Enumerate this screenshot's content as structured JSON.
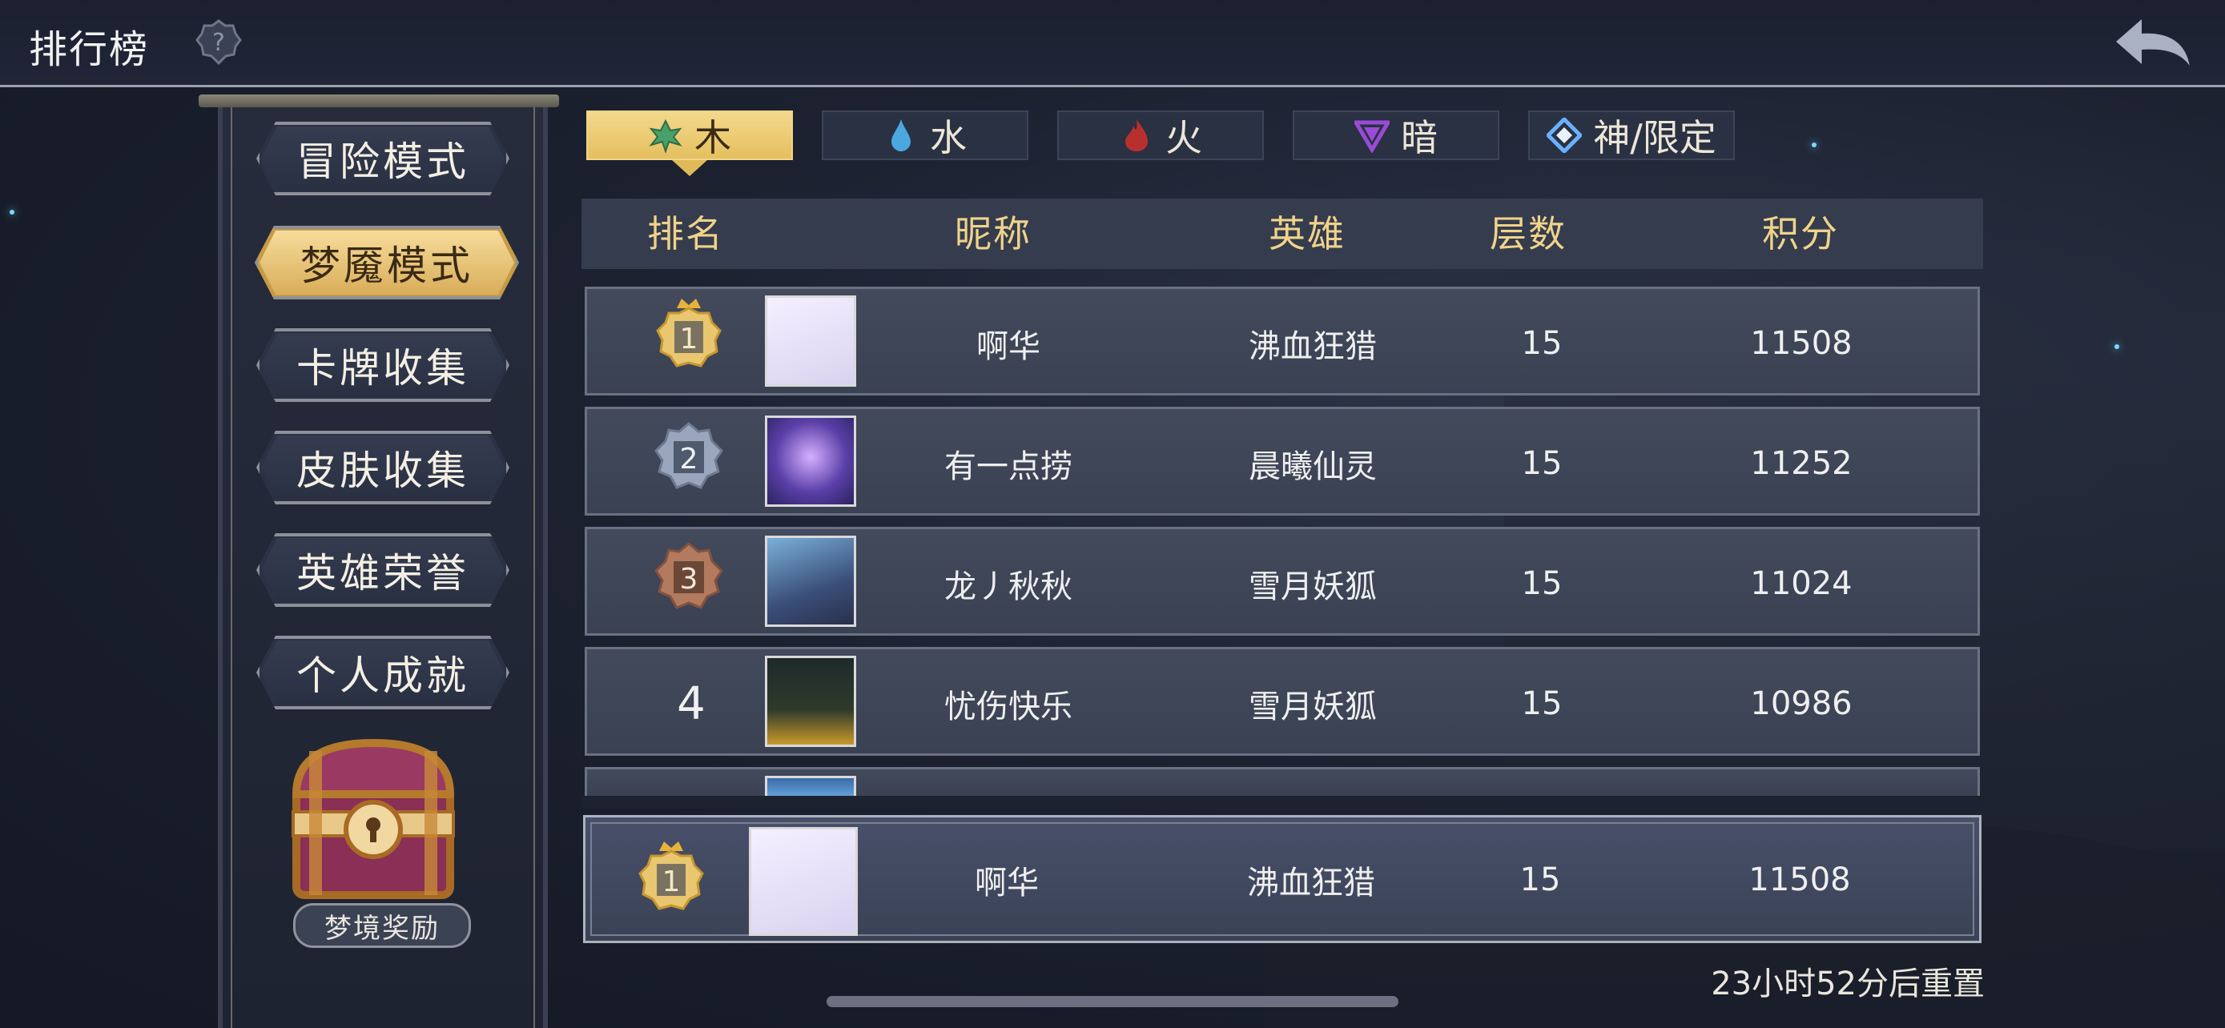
{
  "header": {
    "title": "排行榜",
    "help_icon": "question-gear-icon",
    "back_icon": "back-arrow-icon"
  },
  "sidebar": {
    "items": [
      {
        "label": "冒险模式",
        "active": false
      },
      {
        "label": "梦魇模式",
        "active": true
      },
      {
        "label": "卡牌收集",
        "active": false
      },
      {
        "label": "皮肤收集",
        "active": false
      },
      {
        "label": "英雄荣誉",
        "active": false
      },
      {
        "label": "个人成就",
        "active": false
      }
    ],
    "reward_label": "梦境奖励"
  },
  "tabs": [
    {
      "label": "木",
      "icon": "leaf-icon",
      "active": true
    },
    {
      "label": "水",
      "icon": "water-drop-icon",
      "active": false
    },
    {
      "label": "火",
      "icon": "fire-icon",
      "active": false
    },
    {
      "label": "暗",
      "icon": "dark-triangle-icon",
      "active": false
    },
    {
      "label": "神/限定",
      "icon": "diamond-icon",
      "active": false
    }
  ],
  "table": {
    "headers": {
      "rank": "排名",
      "nickname": "昵称",
      "hero": "英雄",
      "floors": "层数",
      "score": "积分"
    },
    "rows": [
      {
        "rank": "1",
        "nickname": "啊华",
        "hero": "沸血狂猎",
        "floors": "15",
        "score": "11508"
      },
      {
        "rank": "2",
        "nickname": "有一点捞",
        "hero": "晨曦仙灵",
        "floors": "15",
        "score": "11252"
      },
      {
        "rank": "3",
        "nickname": "龙丿秋秋",
        "hero": "雪月妖狐",
        "floors": "15",
        "score": "11024"
      },
      {
        "rank": "4",
        "nickname": "忧伤快乐",
        "hero": "雪月妖狐",
        "floors": "15",
        "score": "10986"
      }
    ],
    "self": {
      "rank": "1",
      "nickname": "啊华",
      "hero": "沸血狂猎",
      "floors": "15",
      "score": "11508"
    }
  },
  "footer": {
    "reset_text": "23小时52分后重置"
  },
  "colors": {
    "gold": "#f0d38a",
    "tab_active": "#e5bf5f",
    "row_bg": "#3e4658"
  }
}
